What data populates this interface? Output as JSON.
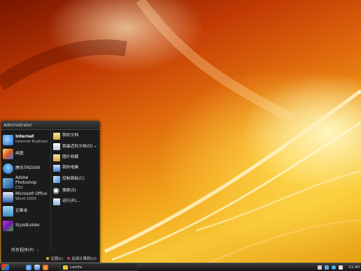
{
  "start_menu": {
    "user": "Administrator",
    "programs": [
      {
        "title": "Internet",
        "subtitle": "Internet Explorer",
        "icon": "internet-explorer-icon"
      },
      {
        "title": "画图",
        "subtitle": "",
        "icon": "paint-icon"
      },
      {
        "title": "腾讯TM2008",
        "subtitle": "",
        "icon": "tencent-tm-icon"
      },
      {
        "title": "Adobe Photoshop",
        "subtitle": "CS2",
        "icon": "photoshop-icon"
      },
      {
        "title": "Microsoft Office",
        "subtitle": "Word 2003",
        "icon": "word-icon"
      },
      {
        "title": "记事本",
        "subtitle": "",
        "icon": "notepad-icon"
      },
      {
        "title": "StyleBuilder",
        "subtitle": "",
        "icon": "stylebuilder-icon"
      }
    ],
    "places": [
      {
        "label": "我的文档",
        "icon": "my-documents-icon"
      },
      {
        "label": "我最近的文档(D)",
        "icon": "recent-documents-icon",
        "has_submenu": true
      },
      {
        "label": "图片收藏",
        "icon": "my-pictures-icon"
      },
      {
        "label": "我的电脑",
        "icon": "my-computer-icon"
      },
      {
        "label": "控制面板(C)",
        "icon": "control-panel-icon"
      },
      {
        "label": "搜索(S)",
        "icon": "search-icon"
      },
      {
        "label": "运行(R)...",
        "icon": "run-icon"
      }
    ],
    "all_programs": "所有程序(P)",
    "log_off": "注销(L)",
    "shut_down": "关闭计算机(U)"
  },
  "taskbar": {
    "task": "Lamfa",
    "clock": "11:40"
  },
  "colors": {
    "menu_bg": "#1b1b1b",
    "taskbar_bg": "#1f1f1f",
    "wallpaper_accent": "#f2a21a"
  }
}
